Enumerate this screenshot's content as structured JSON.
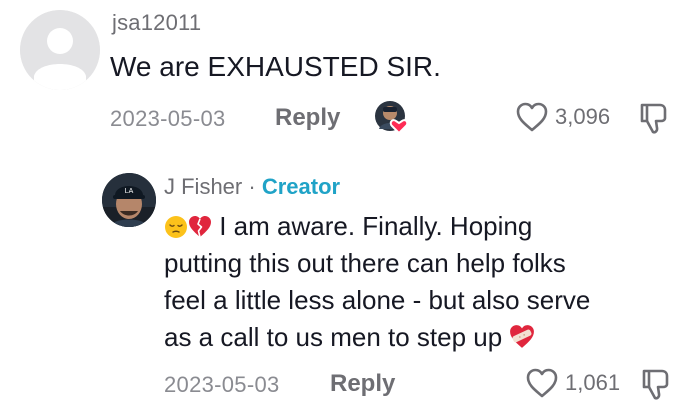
{
  "comment": {
    "username": "jsa12011",
    "text": "We are EXHAUSTED SIR.",
    "date": "2023-05-03",
    "reply_label": "Reply",
    "like_count": "3,096"
  },
  "reply": {
    "author": "J Fisher",
    "separator": "·",
    "badge": "Creator",
    "lines": [
      "I am aware. Finally. Hoping",
      "putting this out there can help folks",
      "feel a little less alone - but also serve",
      "as a call to us men to step up"
    ],
    "date": "2023-05-03",
    "reply_label": "Reply",
    "like_count": "1,061"
  },
  "icons": {
    "heart": "heart-outline-icon",
    "dislike": "thumb-down-icon",
    "creator_liked": "creator-liked-badge-icon",
    "pensive_emoji": "pensive-face-emoji-icon",
    "broken_heart_emoji": "broken-heart-emoji-icon",
    "mending_heart_emoji": "mending-heart-emoji-icon"
  },
  "colors": {
    "creator_badge": "#20a3c7",
    "heart_red": "#fe2c55",
    "muted_text": "#8a8b91"
  }
}
